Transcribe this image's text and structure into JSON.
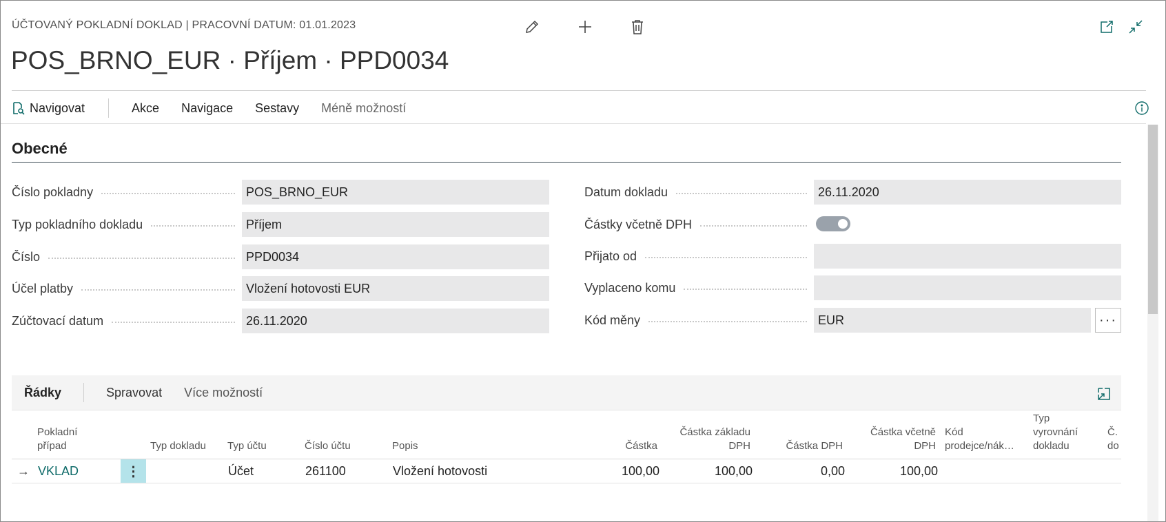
{
  "caption": "ÚČTOVANÝ POKLADNÍ DOKLAD | PRACOVNÍ DATUM: 01.01.2023",
  "title": "POS_BRNO_EUR · Příjem · PPD0034",
  "top_icons": [
    "pencil-icon",
    "plus-icon",
    "trash-icon",
    "open-new-window-icon",
    "collapse-icon"
  ],
  "actionbar": {
    "navigate": "Navigovat",
    "actions": "Akce",
    "navigation": "Navigace",
    "reports": "Sestavy",
    "fewer": "Méně možností"
  },
  "section": {
    "title": "Obecné"
  },
  "fields_left": [
    {
      "label": "Číslo pokladny",
      "value": "POS_BRNO_EUR"
    },
    {
      "label": "Typ pokladního dokladu",
      "value": "Příjem"
    },
    {
      "label": "Číslo",
      "value": "PPD0034"
    },
    {
      "label": "Účel platby",
      "value": "Vložení hotovosti EUR"
    },
    {
      "label": "Zúčtovací datum",
      "value": "26.11.2020"
    }
  ],
  "fields_right": [
    {
      "label": "Datum dokladu",
      "value": "26.11.2020"
    },
    {
      "label": "Částky včetně DPH",
      "toggle": true
    },
    {
      "label": "Přijato od",
      "value": ""
    },
    {
      "label": "Vyplaceno komu",
      "value": ""
    },
    {
      "label": "Kód měny",
      "value": "EUR"
    }
  ],
  "lookup_label": "···",
  "lines": {
    "tab": "Řádky",
    "manage": "Spravovat",
    "more": "Více možností",
    "headers": {
      "case_1": "Pokladní",
      "case_2": "případ",
      "doc_type": "Typ dokladu",
      "acc_type": "Typ účtu",
      "acc_no": "Číslo účtu",
      "desc": "Popis",
      "amount": "Částka",
      "base_1": "Částka základu",
      "base_2": "DPH",
      "vat": "Částka DPH",
      "incl_1": "Částka včetně",
      "incl_2": "DPH",
      "seller_1": "Kód",
      "seller_2": "prodejce/nák…",
      "settle_1": "Typ",
      "settle_2": "vyrovnání",
      "settle_3": "dokladu",
      "cut_1": "Č.",
      "cut_2": "do"
    },
    "row": {
      "arrow": "→",
      "case": "VKLAD",
      "menu": "⋮",
      "doc_type": "",
      "acc_type": "Účet",
      "acc_no": "261100",
      "desc": "Vložení hotovosti",
      "amount": "100,00",
      "base": "100,00",
      "vat": "0,00",
      "incl": "100,00"
    }
  },
  "colors": {
    "accent": "#0f6b69",
    "field_bg": "#e8e8e9",
    "row_highlight": "#b4e3ea"
  }
}
